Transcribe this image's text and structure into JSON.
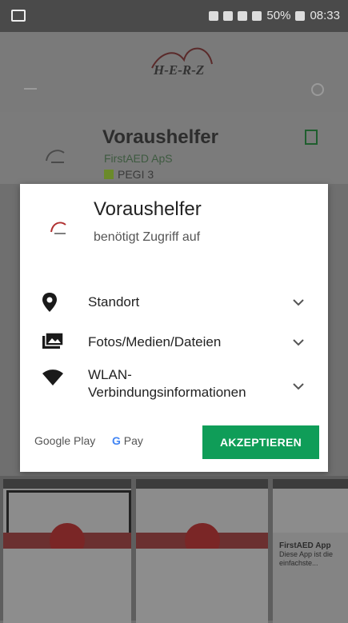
{
  "status_bar": {
    "battery": "50%",
    "time": "08:33"
  },
  "store_page": {
    "logo_text": "H-E-R-Z",
    "app_name": "Voraushelfer",
    "developer": "FirstAED ApS",
    "rating": "PEGI 3"
  },
  "dialog": {
    "title": "Voraushelfer",
    "subtitle": "benötigt Zugriff auf",
    "permissions": [
      {
        "icon": "location-pin-icon",
        "label": "Standort"
      },
      {
        "icon": "photos-folder-icon",
        "label": "Fotos/Medien/Dateien"
      },
      {
        "icon": "wifi-icon",
        "label": "WLAN-\nVerbindungsinformationen"
      }
    ],
    "footer": {
      "google_play": "Google Play",
      "gpay_g": "G",
      "gpay_text": "Pay"
    },
    "accept_label": "AKZEPTIEREN",
    "accent_color": "#0f9d58"
  },
  "screenshots": {
    "third_title": "FirstAED App",
    "third_body": "Diese App ist die einfachste..."
  }
}
